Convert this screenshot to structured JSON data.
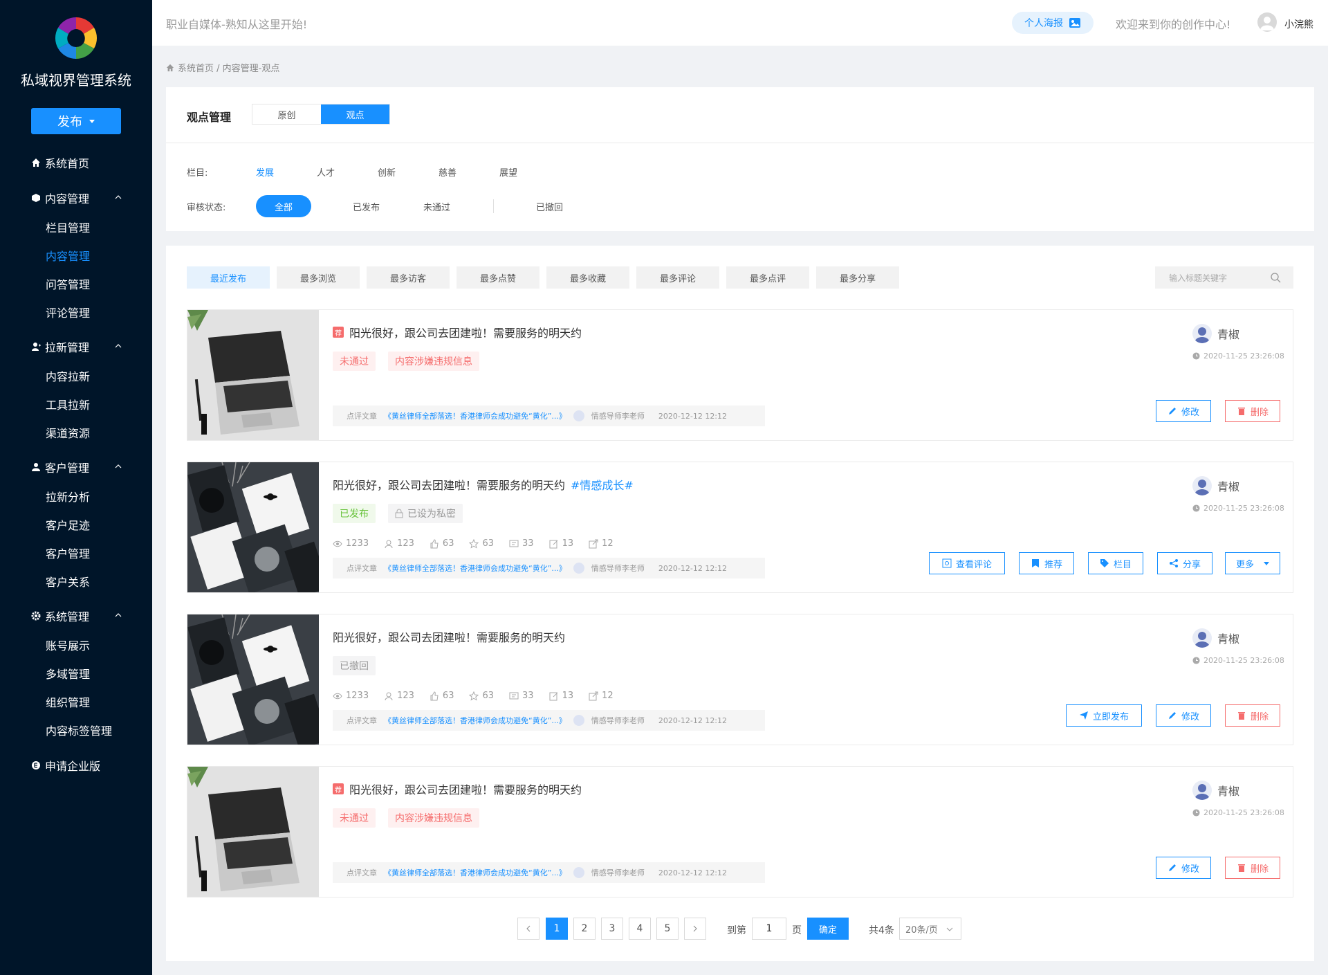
{
  "app": {
    "brand": "私域视界管理系统",
    "publish_label": "发布"
  },
  "sidebar": {
    "home": "系统首页",
    "content": {
      "label": "内容管理",
      "items": [
        "栏目管理",
        "内容管理",
        "问答管理",
        "评论管理"
      ]
    },
    "growth": {
      "label": "拉新管理",
      "items": [
        "内容拉新",
        "工具拉新",
        "渠道资源"
      ]
    },
    "customer": {
      "label": "客户管理",
      "items": [
        "拉新分析",
        "客户足迹",
        "客户管理",
        "客户关系"
      ]
    },
    "system": {
      "label": "系统管理",
      "items": [
        "账号展示",
        "多域管理",
        "组织管理",
        "内容标签管理"
      ]
    },
    "enterprise": "申请企业版",
    "active_item": "内容管理"
  },
  "topbar": {
    "slogan": "职业自媒体-熟知从这里开始!",
    "poster_label": "个人海报",
    "welcome": "欢迎来到你的创作中心!",
    "user_name": "小浣熊"
  },
  "breadcrumb": "系统首页 / 内容管理-观点",
  "filter": {
    "title": "观点管理",
    "segments": [
      "原创",
      "观点"
    ],
    "active_segment": "观点",
    "category_label": "栏目:",
    "categories": [
      "发展",
      "人才",
      "创新",
      "慈善",
      "展望"
    ],
    "active_category": "发展",
    "status_label": "审核状态:",
    "statuses": [
      "全部",
      "已发布",
      "未通过",
      "已撤回"
    ],
    "active_status": "全部"
  },
  "sort_tabs": [
    "最近发布",
    "最多浏览",
    "最多访客",
    "最多点赞",
    "最多收藏",
    "最多评论",
    "最多点评",
    "最多分享"
  ],
  "active_sort": "最近发布",
  "search_placeholder": "输入标题关键字",
  "items": [
    {
      "rec_badge": "荐",
      "title": "阳光很好，跟公司去团建啦！需要服务的明天约",
      "hashtag": "",
      "tags": [
        "未通过",
        "内容涉嫌违规信息"
      ],
      "ref": {
        "label": "点评文章",
        "link": "《黄丝律师全部落选！香港律师会成功避免“黄化”...》",
        "user": "情感导师李老师",
        "date": "2020-12-12 12:12"
      },
      "author": "青椒",
      "time": "2020-11-25 23:26:08",
      "buttons": [
        "修改",
        "删除"
      ]
    },
    {
      "title": "阳光很好，跟公司去团建啦！需要服务的明天约",
      "hashtag": "#情感成长#",
      "tags": [
        "已发布",
        "已设为私密"
      ],
      "stats": [
        "1233",
        "123",
        "63",
        "63",
        "33",
        "13",
        "12"
      ],
      "ref": {
        "label": "点评文章",
        "link": "《黄丝律师全部落选！香港律师会成功避免“黄化”...》",
        "user": "情感导师李老师",
        "date": "2020-12-12 12:12"
      },
      "author": "青椒",
      "time": "2020-11-25 23:26:08",
      "buttons": [
        "查看评论",
        "推荐",
        "栏目",
        "分享",
        "更多"
      ]
    },
    {
      "title": "阳光很好，跟公司去团建啦！需要服务的明天约",
      "hashtag": "",
      "tags": [
        "已撤回"
      ],
      "stats": [
        "1233",
        "123",
        "63",
        "63",
        "33",
        "13",
        "12"
      ],
      "ref": {
        "label": "点评文章",
        "link": "《黄丝律师全部落选！香港律师会成功避免“黄化”...》",
        "user": "情感导师李老师",
        "date": "2020-12-12 12:12"
      },
      "author": "青椒",
      "time": "2020-11-25 23:26:08",
      "buttons": [
        "立即发布",
        "修改",
        "删除"
      ]
    },
    {
      "rec_badge": "荐",
      "title": "阳光很好，跟公司去团建啦！需要服务的明天约",
      "hashtag": "",
      "tags": [
        "未通过",
        "内容涉嫌违规信息"
      ],
      "ref": {
        "label": "点评文章",
        "link": "《黄丝律师全部落选！香港律师会成功避免“黄化”...》",
        "user": "情感导师李老师",
        "date": "2020-12-12 12:12"
      },
      "author": "青椒",
      "time": "2020-11-25 23:26:08",
      "buttons": [
        "修改",
        "删除"
      ]
    }
  ],
  "pagination": {
    "pages": [
      "1",
      "2",
      "3",
      "4",
      "5"
    ],
    "current": "1",
    "goto_label": "到第",
    "goto_value": "1",
    "page_unit": "页",
    "confirm": "确定",
    "total": "共4条",
    "page_size": "20条/页"
  },
  "colors": {
    "sidebar_bg": "#001529",
    "primary": "#1890ff",
    "danger": "#f56c6c",
    "success": "#67c23a"
  }
}
